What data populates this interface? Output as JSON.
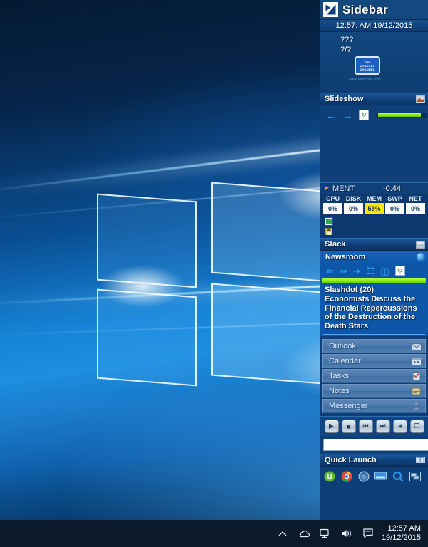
{
  "desktop": {
    "wallpaper_name": "windows-10-hero-wallpaper"
  },
  "taskbar": {
    "show_hidden_icons_label": "^",
    "tray_icons": [
      {
        "name": "onedrive-icon",
        "glyph": "☁"
      },
      {
        "name": "network-icon",
        "glyph": "▣"
      },
      {
        "name": "volume-icon",
        "glyph": "◂"
      },
      {
        "name": "action-center-icon",
        "glyph": "▭"
      }
    ],
    "clock_time": "12:57 AM",
    "clock_date": "19/12/2015"
  },
  "sidebar": {
    "title": "Sidebar",
    "logo_name": "sidebar-logo-icon",
    "clock_text": "12:57: AM 19/12/2015",
    "weather": {
      "temperature": "???",
      "condition": "?/?",
      "logo_line1": "THE",
      "logo_line2": "WEATHER",
      "logo_line3": "CHANNEL",
      "url": "www.weather.com"
    },
    "slideshow": {
      "title": "Slideshow",
      "prev_label": "←",
      "next_label": "→",
      "refresh_label": "↻",
      "progress_percent": 88
    },
    "sysinfo": {
      "name": "MENT",
      "value": "-0.44",
      "columns": [
        "CPU",
        "DISK",
        "MEM",
        "SWP",
        "NET"
      ],
      "values": [
        "0%",
        "0%",
        "55%",
        "0%",
        "0%"
      ],
      "warn_index": 2,
      "warn_color": "#ffe400"
    },
    "stack": {
      "title": "Stack",
      "newsroom": {
        "title": "Newsroom",
        "tools": [
          {
            "name": "back-icon",
            "glyph": "⇐"
          },
          {
            "name": "forward-icon",
            "glyph": "⇒"
          },
          {
            "name": "next-item-icon",
            "glyph": "⇥"
          },
          {
            "name": "feed-icon",
            "glyph": "☷"
          },
          {
            "name": "book-icon",
            "glyph": "◫"
          },
          {
            "name": "refresh-icon",
            "glyph": "↻"
          }
        ],
        "progress_percent": 100,
        "source": "Slashdot (20)",
        "headline": "Economists Discuss the Financial Repercussions of the Destruction of the Death Stars"
      },
      "panels": [
        {
          "label": "Outlook",
          "icon": "mail-icon",
          "glyph": "✉"
        },
        {
          "label": "Calendar",
          "icon": "calendar-icon",
          "glyph": "Ὄ5"
        },
        {
          "label": "Tasks",
          "icon": "checklist-icon",
          "glyph": "☑"
        },
        {
          "label": "Notes",
          "icon": "notes-icon",
          "glyph": "✎"
        },
        {
          "label": "Messenger",
          "icon": "person-icon",
          "glyph": "♟"
        }
      ]
    },
    "media_controls": [
      {
        "name": "play-button",
        "glyph": "▶"
      },
      {
        "name": "stop-button",
        "glyph": "■"
      },
      {
        "name": "previous-button",
        "glyph": "⏮"
      },
      {
        "name": "next-button",
        "glyph": "⏭"
      },
      {
        "name": "volume-button",
        "glyph": "◂"
      },
      {
        "name": "restore-button",
        "glyph": "❐"
      }
    ],
    "search": {
      "value": "",
      "placeholder": "",
      "go_label": "➜"
    },
    "quick_launch": {
      "title": "Quick Launch",
      "icons": [
        {
          "name": "utorrent-icon",
          "glyph": "µ",
          "color": "#5bbd2a"
        },
        {
          "name": "chrome-icon",
          "glyph": "◉",
          "color": "#e8453c"
        },
        {
          "name": "disk-shield-icon",
          "glyph": "●",
          "color": "#4f8fd0"
        },
        {
          "name": "display-icon",
          "glyph": "▬",
          "color": "#2f8fe0"
        },
        {
          "name": "search-icon",
          "glyph": "○",
          "color": "#2f8fe0"
        },
        {
          "name": "switch-window-icon",
          "glyph": "⧉",
          "color": "#7fb3e0"
        }
      ]
    }
  }
}
